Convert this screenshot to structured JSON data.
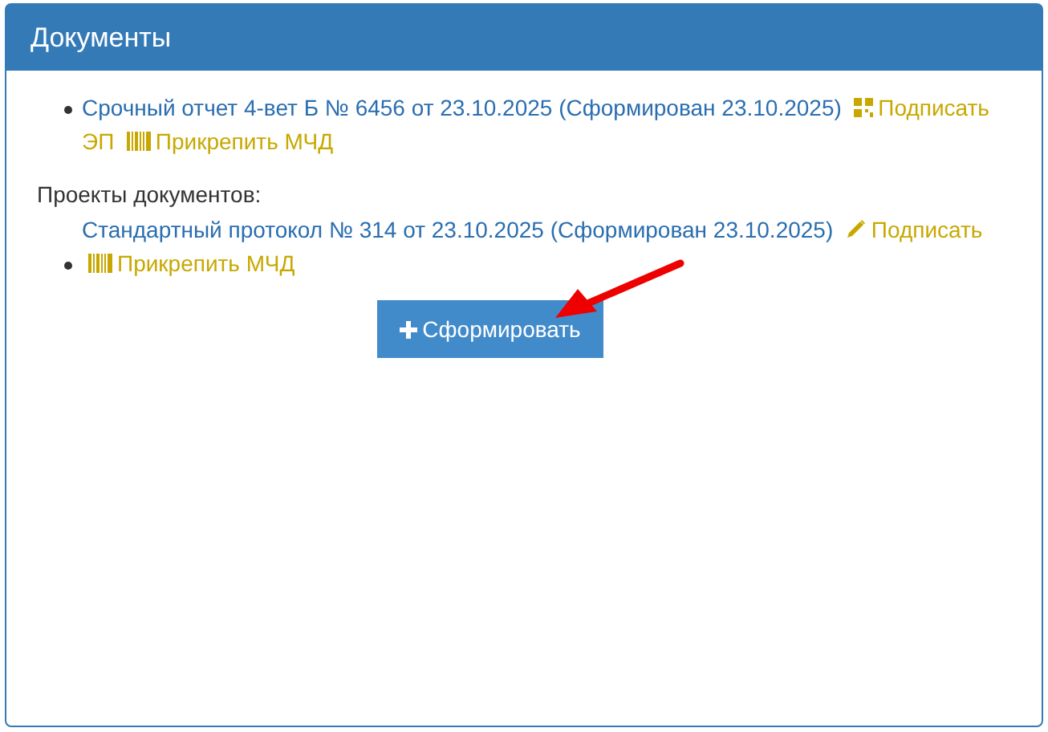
{
  "panel": {
    "title": "Документы"
  },
  "documents": [
    {
      "title": "Срочный отчет 4-вет Б № 6456 от 23.10.2025 (Сформирован 23.10.2025)",
      "sign": {
        "label_parts": [
          "Подписать",
          "ЭП"
        ]
      },
      "attach": "Прикрепить МЧД"
    }
  ],
  "drafts": {
    "label": "Проекты документов:",
    "items": [
      {
        "title": "Стандартный протокол № 314 от 23.10.2025 (Сформирован 23.10.2025)",
        "sign": {
          "label_parts": [
            "Подписать"
          ]
        },
        "attach": "Прикрепить МЧД"
      }
    ]
  },
  "create_button": {
    "label": "Сформировать"
  }
}
